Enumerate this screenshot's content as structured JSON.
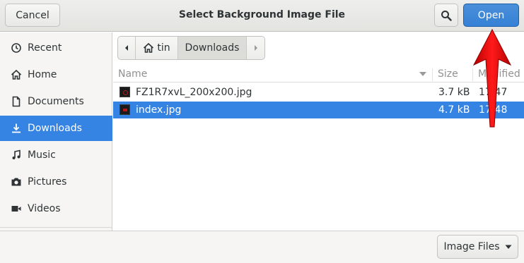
{
  "header": {
    "title": "Select Background Image File",
    "cancel_label": "Cancel",
    "open_label": "Open",
    "search_icon": "search-icon"
  },
  "sidebar": {
    "items": [
      {
        "label": "Recent",
        "icon": "clock-icon",
        "selected": false
      },
      {
        "label": "Home",
        "icon": "home-icon",
        "selected": false
      },
      {
        "label": "Documents",
        "icon": "document-icon",
        "selected": false
      },
      {
        "label": "Downloads",
        "icon": "download-icon",
        "selected": true
      },
      {
        "label": "Music",
        "icon": "music-icon",
        "selected": false
      },
      {
        "label": "Pictures",
        "icon": "camera-icon",
        "selected": false
      },
      {
        "label": "Videos",
        "icon": "video-icon",
        "selected": false
      }
    ]
  },
  "pathbar": {
    "home_label": "tin",
    "current_label": "Downloads"
  },
  "file_list": {
    "columns": {
      "name": "Name",
      "size": "Size",
      "modified": "Modified"
    },
    "rows": [
      {
        "name": "FZ1R7xvL_200x200.jpg",
        "size": "3.7 kB",
        "modified": "17:47",
        "selected": false
      },
      {
        "name": "index.jpg",
        "size": "4.7 kB",
        "modified": "17:48",
        "selected": true
      }
    ]
  },
  "footer": {
    "filter_label": "Image Files"
  },
  "colors": {
    "accent": "#3584e4",
    "annotation_arrow": "#e00000"
  }
}
